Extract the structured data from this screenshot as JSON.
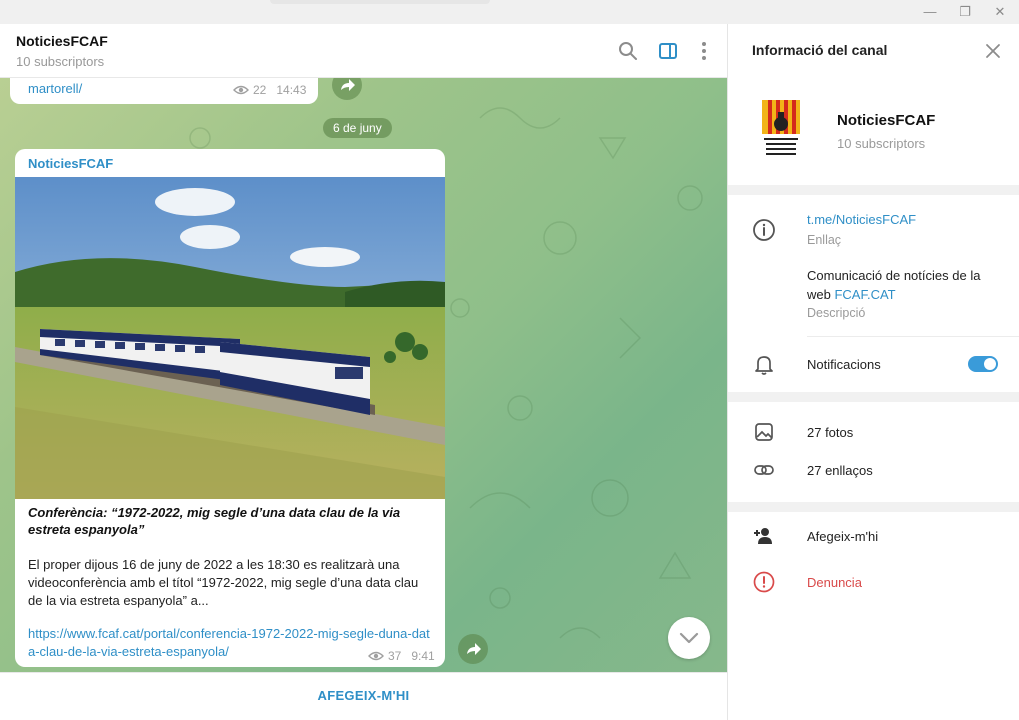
{
  "window": {
    "minimize": "—",
    "restore": "❐",
    "close": "✕"
  },
  "chat": {
    "title": "NoticiesFCAF",
    "subscribers": "10 subscriptors",
    "prev_message": {
      "link": "martorell/",
      "views": "22",
      "time": "14:43"
    },
    "date_separator": "6 de juny",
    "post": {
      "sender": "NoticiesFCAF",
      "title": "Conferència: “1972-2022, mig segle d’una data clau de la via estreta espanyola”",
      "body": "El proper dijous 16 de juny de 2022 a les 18:30 es realitzarà una videoconferència amb el títol “1972-2022, mig segle d’una data clau de la via estreta espanyola” a...",
      "link": "https://www.fcaf.cat/portal/conferencia-1972-2022-mig-segle-duna-data-clau-de-la-via-estreta-espanyola/",
      "views": "37",
      "time": "9:41"
    },
    "join_button": "AFEGEIX-M'HI"
  },
  "panel": {
    "title": "Informació del canal",
    "channel_name": "NoticiesFCAF",
    "channel_subscribers": "10 subscriptors",
    "logo_text": "FEDERACIÓ CATALANA D'AMICS DEL FERROCARRIL",
    "link": "t.me/NoticiesFCAF",
    "link_label": "Enllaç",
    "description_text": "Comunicació de notícies de la web ",
    "description_link": "FCAF.CAT",
    "description_label": "Descripció",
    "notifications_label": "Notificacions",
    "notifications_on": true,
    "photos": "27 fotos",
    "links": "27 enllaços",
    "add": "Afegeix-m'hi",
    "report": "Denuncia"
  },
  "colors": {
    "accent": "#2f8fc7",
    "toggle": "#3a9bd9",
    "danger": "#d94a4a"
  }
}
